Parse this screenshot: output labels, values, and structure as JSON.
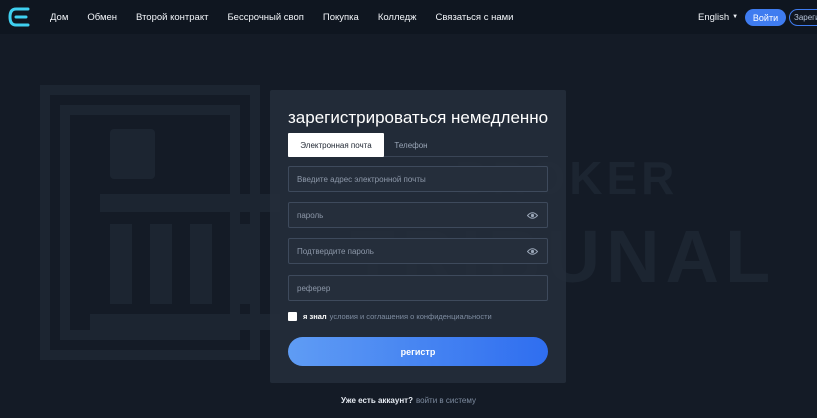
{
  "header": {
    "nav": [
      "Дом",
      "Обмен",
      "Второй контракт",
      "Бессрочный своп",
      "Покупка",
      "Колледж",
      "Связаться с нами"
    ],
    "language": "English",
    "login_label": "Войти",
    "register_label": "Зарегистрироваться"
  },
  "watermark": {
    "line1": "BROKER",
    "line2": "TRIBUNAL"
  },
  "form": {
    "title": "зарегистрироваться немедленно",
    "tabs": [
      "Электронная почта",
      "Телефон"
    ],
    "email_placeholder": "Введите адрес электронной почты",
    "password_placeholder": "пароль",
    "confirm_placeholder": "Подтвердите пароль",
    "referrer_placeholder": "реферер",
    "agree_prefix": "я знал",
    "agree_link": "условия и соглашения о конфиденциальности",
    "submit_label": "регистр"
  },
  "footer": {
    "question": "Уже есть аккаунт?",
    "login_link": "войти в систему"
  },
  "colors": {
    "background": "#141b26",
    "header": "#0f1620",
    "accent": "#3f7cf0",
    "card": "#242d3a"
  }
}
